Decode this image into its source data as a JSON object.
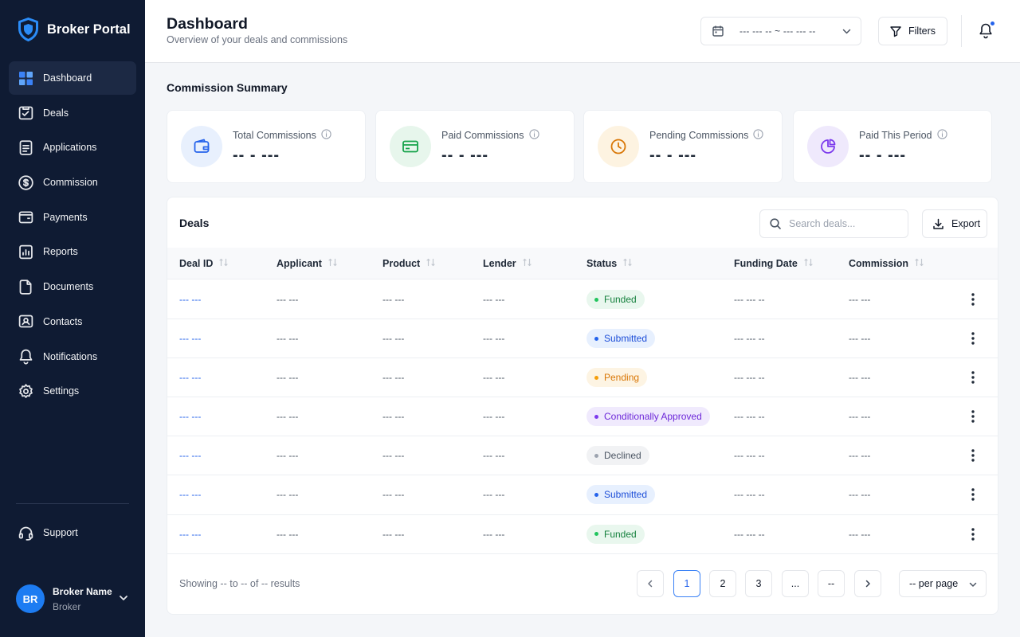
{
  "app": {
    "brand": "Broker Portal"
  },
  "sidebar": {
    "items": [
      {
        "label": "Dashboard",
        "icon": "grid-icon",
        "active": true
      },
      {
        "label": "Deals",
        "icon": "briefcase-icon"
      },
      {
        "label": "Applications",
        "icon": "document-list-icon"
      },
      {
        "label": "Commission",
        "icon": "dollar-badge-icon"
      },
      {
        "label": "Payments",
        "icon": "wallet-icon"
      },
      {
        "label": "Reports",
        "icon": "chart-report-icon"
      },
      {
        "label": "Documents",
        "icon": "file-icon"
      },
      {
        "label": "Contacts",
        "icon": "contacts-icon"
      },
      {
        "label": "Notifications",
        "icon": "bell-icon"
      },
      {
        "label": "Settings",
        "icon": "gear-icon"
      }
    ],
    "support_label": "Support",
    "user": {
      "initials": "BR",
      "name": "Broker Name",
      "role": "Broker"
    }
  },
  "header": {
    "title": "Dashboard",
    "subtitle": "Overview of your deals and commissions",
    "date_range": "--- --- -- ~ --- --- --",
    "filters_label": "Filters"
  },
  "summary": {
    "title": "Commission Summary",
    "cards": [
      {
        "label": "Total Commissions",
        "value": "-- - ---",
        "icon": "wallet-icon",
        "color": "#2563eb",
        "bg": "#e8f0fd"
      },
      {
        "label": "Paid Commissions",
        "value": "-- - ---",
        "icon": "credit-card-icon",
        "color": "#16a34a",
        "bg": "#e7f6ec"
      },
      {
        "label": "Pending Commissions",
        "value": "-- - ---",
        "icon": "clock-icon",
        "color": "#d97706",
        "bg": "#fdf3e1"
      },
      {
        "label": "Paid This Period",
        "value": "-- - ---",
        "icon": "pie-chart-icon",
        "color": "#7c3aed",
        "bg": "#efe9fc"
      }
    ]
  },
  "deals": {
    "title": "Deals",
    "search_placeholder": "Search deals...",
    "export_label": "Export",
    "columns": [
      "Deal ID",
      "Applicant",
      "Product",
      "Lender",
      "Status",
      "Funding Date",
      "Commission"
    ],
    "rows": [
      {
        "id": "--- ---",
        "applicant": "--- ---",
        "product": "--- ---",
        "lender": "--- ---",
        "status": "Funded",
        "date": "--- --- --",
        "commission": "--- ---"
      },
      {
        "id": "--- ---",
        "applicant": "--- ---",
        "product": "--- ---",
        "lender": "--- ---",
        "status": "Submitted",
        "date": "--- --- --",
        "commission": "--- ---"
      },
      {
        "id": "--- ---",
        "applicant": "--- ---",
        "product": "--- ---",
        "lender": "--- ---",
        "status": "Pending",
        "date": "--- --- --",
        "commission": "--- ---"
      },
      {
        "id": "--- ---",
        "applicant": "--- ---",
        "product": "--- ---",
        "lender": "--- ---",
        "status": "Conditionally Approved",
        "date": "--- --- --",
        "commission": "--- ---"
      },
      {
        "id": "--- ---",
        "applicant": "--- ---",
        "product": "--- ---",
        "lender": "--- ---",
        "status": "Declined",
        "date": "--- --- --",
        "commission": "--- ---"
      },
      {
        "id": "--- ---",
        "applicant": "--- ---",
        "product": "--- ---",
        "lender": "--- ---",
        "status": "Submitted",
        "date": "--- --- --",
        "commission": "--- ---"
      },
      {
        "id": "--- ---",
        "applicant": "--- ---",
        "product": "--- ---",
        "lender": "--- ---",
        "status": "Funded",
        "date": "--- --- --",
        "commission": "--- ---"
      }
    ],
    "status_colors": {
      "Funded": {
        "text": "#15803d",
        "bg": "#e9f7ee",
        "dot": "#22c55e"
      },
      "Submitted": {
        "text": "#1d4ed8",
        "bg": "#e7f0fe",
        "dot": "#2563eb"
      },
      "Pending": {
        "text": "#d97706",
        "bg": "#fdf4e3",
        "dot": "#f59e0b"
      },
      "Conditionally Approved": {
        "text": "#6d28d9",
        "bg": "#f0eafd",
        "dot": "#7c3aed"
      },
      "Declined": {
        "text": "#4b5563",
        "bg": "#f1f2f4",
        "dot": "#9ca3af"
      }
    },
    "pagination": {
      "info": "Showing -- to -- of -- results",
      "pages": [
        "1",
        "2",
        "3",
        "...",
        "--"
      ],
      "current": "1",
      "per_page": "-- per page"
    }
  }
}
